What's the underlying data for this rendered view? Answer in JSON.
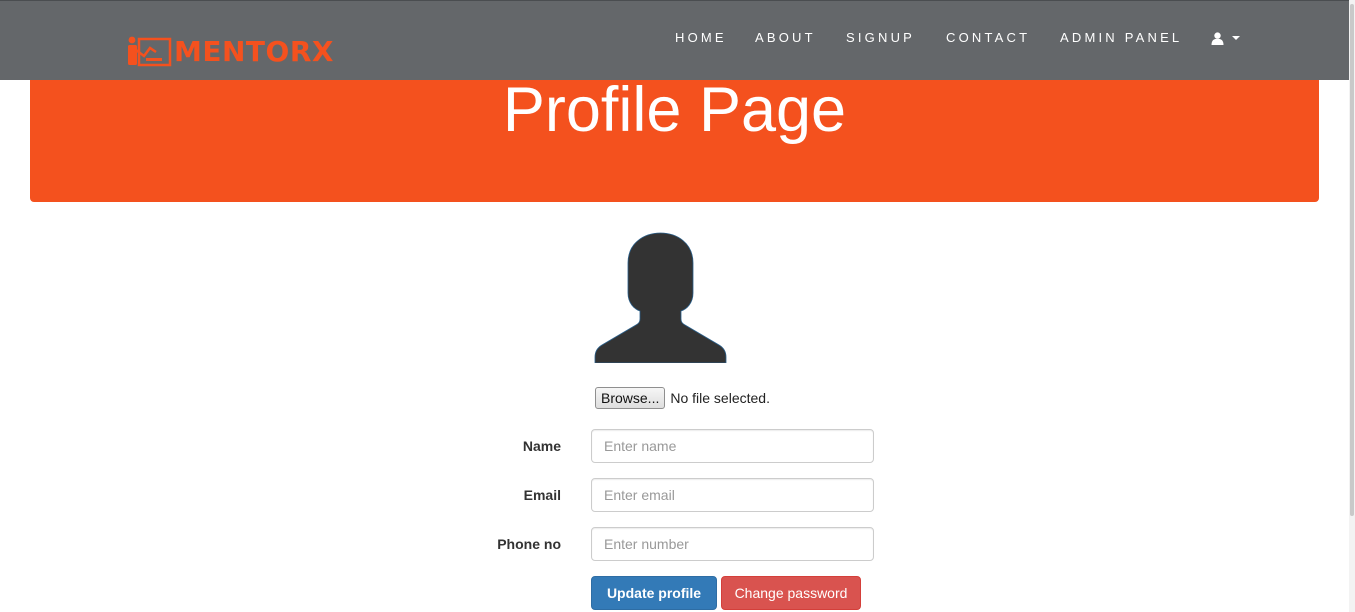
{
  "brand": {
    "name": "MENTORX",
    "color": "#f4511e"
  },
  "nav": {
    "items": [
      {
        "label": "HOME"
      },
      {
        "label": "ABOUT"
      },
      {
        "label": "SIGNUP"
      },
      {
        "label": "CONTACT"
      },
      {
        "label": "ADMIN PANEL"
      }
    ],
    "user_menu_icon": "user-icon",
    "background": "#64676a"
  },
  "header": {
    "title": "Profile Page",
    "background": "#f4511e"
  },
  "profile": {
    "avatar_icon": "user-silhouette-icon",
    "file_input": {
      "button_label": "Browse...",
      "status": "No file selected."
    }
  },
  "form": {
    "name": {
      "label": "Name",
      "placeholder": "Enter name",
      "value": ""
    },
    "email": {
      "label": "Email",
      "placeholder": "Enter email",
      "value": ""
    },
    "phone": {
      "label": "Phone no",
      "placeholder": "Enter number",
      "value": ""
    },
    "update_button": "Update profile",
    "change_password_button": "Change password"
  }
}
